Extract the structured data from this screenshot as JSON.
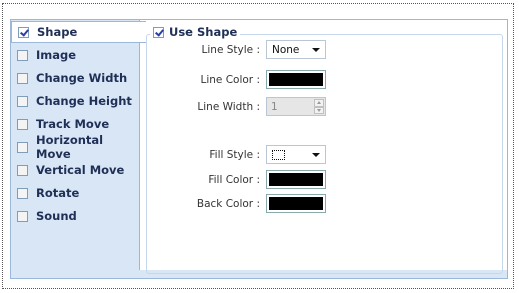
{
  "properties": [
    {
      "label": "Shape",
      "checked": true,
      "selected": true
    },
    {
      "label": "Image",
      "checked": false
    },
    {
      "label": "Change Width",
      "checked": false
    },
    {
      "label": "Change Height",
      "checked": false
    },
    {
      "label": "Track Move",
      "checked": false
    },
    {
      "label": "Horizontal Move",
      "checked": false
    },
    {
      "label": "Vertical Move",
      "checked": false
    },
    {
      "label": "Rotate",
      "checked": false
    },
    {
      "label": "Sound",
      "checked": false
    }
  ],
  "shape_panel": {
    "use_shape_label": "Use Shape",
    "use_shape_checked": true,
    "line_style_label": "Line Style :",
    "line_style_value": "None",
    "line_color_label": "Line Color :",
    "line_color_value": "#000000",
    "line_width_label": "Line Width :",
    "line_width_value": "1",
    "fill_style_label": "Fill Style :",
    "fill_style_icon": "dotted-rectangle-icon",
    "fill_color_label": "Fill Color :",
    "fill_color_value": "#000000",
    "back_color_label": "Back Color :",
    "back_color_value": "#000000"
  },
  "colors": {
    "panel_background": "#d8e6f6",
    "label_text": "#1f2f55"
  }
}
